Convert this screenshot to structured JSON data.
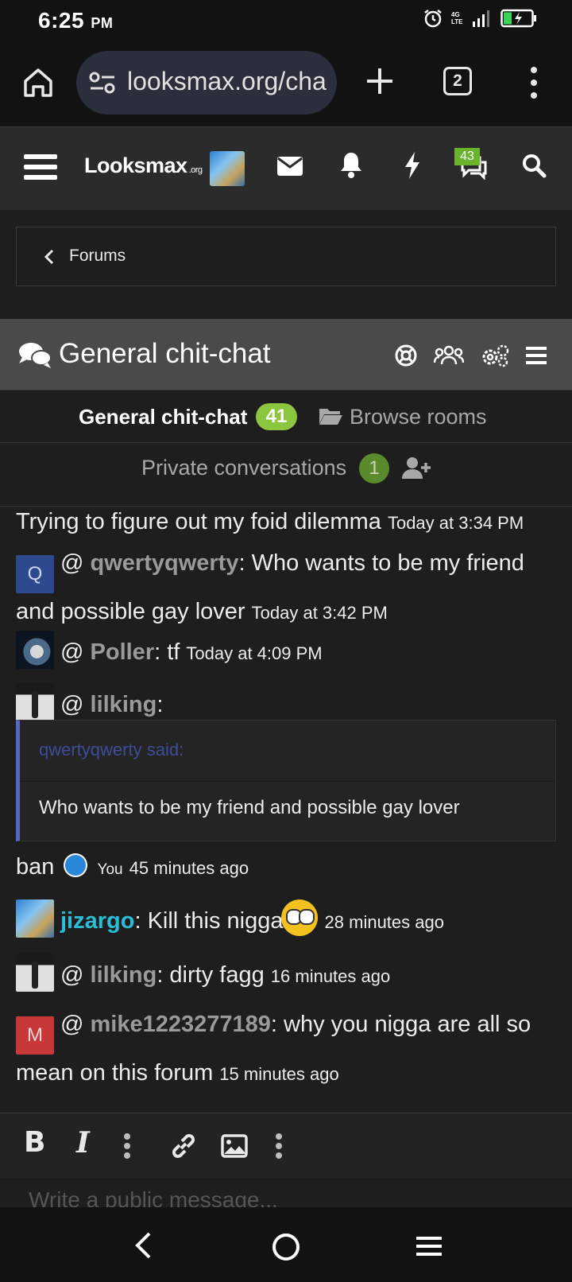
{
  "status_bar": {
    "time": "6:25",
    "ampm": "PM",
    "network": "4G LTE"
  },
  "browser": {
    "url": "looksmax.org/cha",
    "tab_count": "2"
  },
  "site_header": {
    "logo_main": "Looksmax",
    "logo_suffix": ".org",
    "chat_badge": "43"
  },
  "breadcrumb": {
    "label": "Forums"
  },
  "chat": {
    "title": "General chit-chat",
    "current_room": "General chit-chat",
    "current_room_count": "41",
    "browse_rooms": "Browse rooms",
    "private_label": "Private conversations",
    "private_count": "1"
  },
  "messages": [
    {
      "text": "Trying to figure out my foid dilemma",
      "time": "Today at 3:34 PM"
    },
    {
      "avatar_letter": "Q",
      "mention": "@",
      "user": "qwertyqwerty",
      "text": ": Who wants to be my friend and possible gay lover",
      "time": "Today at 3:42 PM"
    },
    {
      "mention": "@",
      "user": "Poller",
      "text": ": tf",
      "time": "Today at 4:09 PM"
    },
    {
      "mention": "@",
      "user": "lilking",
      "text": ":"
    },
    {
      "quote_header": "qwertyqwerty said:",
      "quote_body": "Who wants to be my friend and possible gay lover"
    },
    {
      "text": "ban",
      "reaction_by": "You",
      "time": "45 minutes ago"
    },
    {
      "user": "jizargo",
      "text": ": Kill this nigga",
      "time": "28 minutes ago"
    },
    {
      "mention": "@",
      "user": "lilking",
      "text": ": dirty fagg",
      "time": "16 minutes ago"
    },
    {
      "avatar_letter": "M",
      "mention": "@",
      "user": "mike1223277189",
      "text": ": why you nigga are all so mean on this forum",
      "time": "15 minutes ago"
    }
  ],
  "editor": {
    "bold_label": "B",
    "italic_label": "I",
    "placeholder": "Write a public message..."
  },
  "colors": {
    "accent_green": "#8cc63f",
    "mention_blue": "#2bbcd8",
    "quote_border": "#5b66c4"
  }
}
